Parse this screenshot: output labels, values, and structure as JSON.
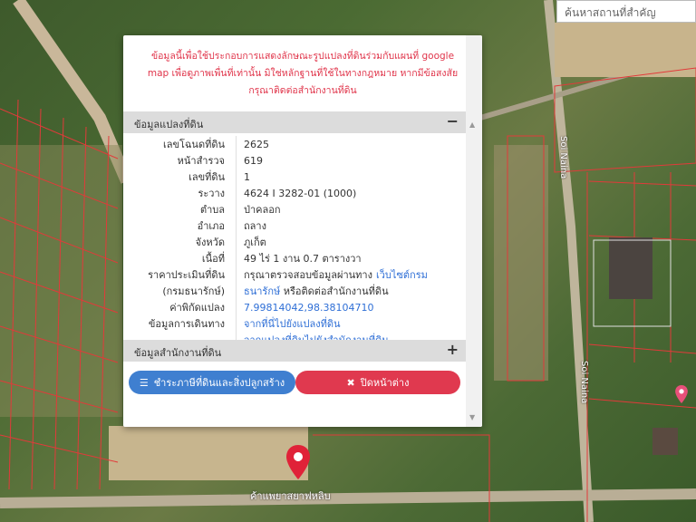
{
  "search": {
    "placeholder": "ค้นหาสถานที่สำคัญ"
  },
  "popup": {
    "close_label": "×",
    "notice": "ข้อมูลนี้เพื่อใช้ประกอบการแสดงลักษณะรูปแปลงที่ดินร่วมกับแผนที่ google map เพื่อดูภาพเพื่นที่เท่านั้น มิใช่หลักฐานที่ใช้ในทางกฎหมาย หากมีข้อสงสัยกรุณาติดต่อสำนักงานที่ดิน",
    "section_land": {
      "title": "ข้อมูลแปลงที่ดิน",
      "sign": "−"
    },
    "section_office": {
      "title": "ข้อมูลสำนักงานที่ดิน",
      "sign": "+"
    },
    "rows": [
      {
        "label": "เลขโฉนดที่ดิน",
        "value": "2625"
      },
      {
        "label": "หน้าสำรวจ",
        "value": "619"
      },
      {
        "label": "เลขที่ดิน",
        "value": "1"
      },
      {
        "label": "ระวาง",
        "value": "4624 I 3282-01 (1000)"
      },
      {
        "label": "ตำบล",
        "value": "ป่าคลอก"
      },
      {
        "label": "อำเภอ",
        "value": "ถลาง"
      },
      {
        "label": "จังหวัด",
        "value": "ภูเก็ต"
      },
      {
        "label": "เนื้อที่",
        "value": "49 ไร่ 1 งาน 0.7 ตารางวา"
      },
      {
        "label": "ราคาประเมินที่ดิน",
        "value": "กรุณาตรวจสอบข้อมูลผ่านทาง",
        "link": "เว็บไซต์กรม"
      },
      {
        "label": "(กรมธนารักษ์)",
        "value": "",
        "link": "ธนารักษ์",
        "value2": " หรือติดต่อสำนักงานที่ดิน"
      },
      {
        "label": "ค่าพิกัดแปลง",
        "value": "",
        "link": "7.99814042,98.38104710"
      },
      {
        "label": "ข้อมูลการเดินทาง",
        "value": "",
        "link": "จากที่นี่ไปยังแปลงที่ดิน"
      },
      {
        "label": "",
        "value": "",
        "link": "จากแปลงที่ดินไปยังสำนักงานที่ดิน"
      }
    ],
    "btn_tax": "ชำระภาษีที่ดินและสิ่งปลูกสร้าง",
    "btn_close": "ปิดหน้าต่าง"
  },
  "map": {
    "road_label_1": "Soi Naina",
    "road_label_2": "Soi Naina",
    "pin_label": "ค้าแพยาสยาฟหลิบ"
  },
  "colors": {
    "notice": "#e0344a",
    "btn_blue": "#3f7fd0",
    "btn_red": "#e0394f",
    "link": "#2f6fd6"
  }
}
